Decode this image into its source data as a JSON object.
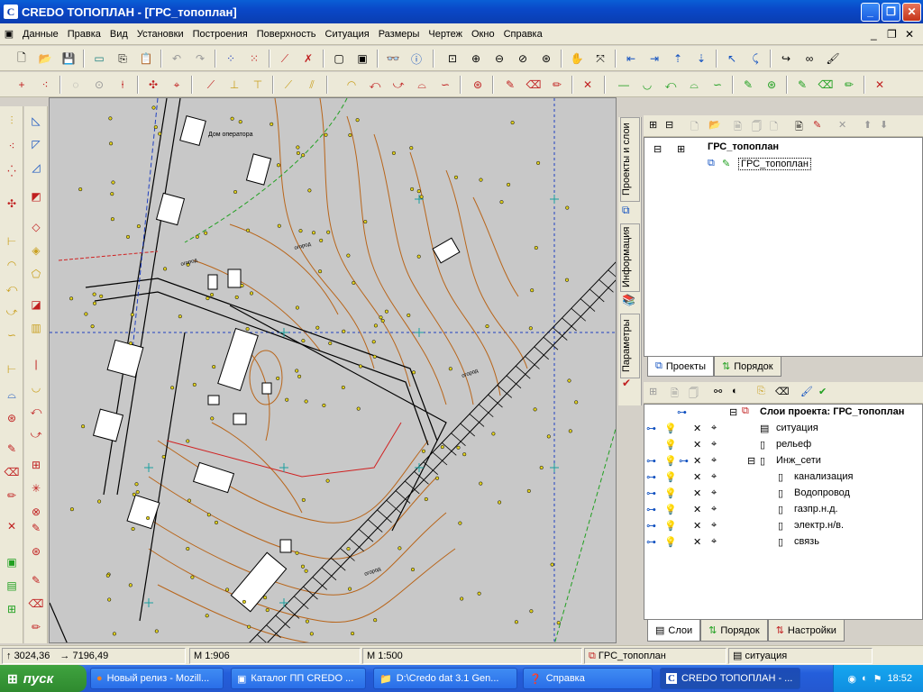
{
  "window": {
    "title": "CREDO ТОПОПЛАН - [ГРС_топоплан]",
    "app_letter": "C"
  },
  "menu": [
    "Данные",
    "Правка",
    "Вид",
    "Установки",
    "Построения",
    "Поверхность",
    "Ситуация",
    "Размеры",
    "Чертеж",
    "Окно",
    "Справка"
  ],
  "side_tabs": [
    "Проекты и слои",
    "Информация",
    "Параметры"
  ],
  "projects_panel": {
    "root": "ГРС_топоплан",
    "child": "ГРС_топоплан",
    "tabs": [
      "Проекты",
      "Порядок"
    ]
  },
  "layers_panel": {
    "header": "Слои проекта: ГРС_топоплан",
    "layers": [
      "ситуация",
      "рельеф",
      "Инж_сети",
      "канализация",
      "Водопровод",
      "газпр.н.д.",
      "электр.н/в.",
      "связь"
    ],
    "tabs": [
      "Слои",
      "Порядок",
      "Настройки"
    ]
  },
  "status": {
    "coord_y": "3024,36",
    "coord_x": "7196,49",
    "scale1": "М 1:906",
    "scale2": "М 1:500",
    "project": "ГРС_топоплан",
    "layer": "ситуация"
  },
  "taskbar": {
    "start": "пуск",
    "tasks": [
      "Новый релиз - Mozill...",
      "Каталог ПП CREDO ...",
      "D:\\Credo dat 3.1 Gen...",
      "Справка",
      "CREDO ТОПОПЛАН - ..."
    ],
    "time": "18:52"
  },
  "map_labels": [
    "Дом оператора",
    "огород",
    "огород",
    "огород",
    "огород"
  ],
  "colors": {
    "accent": "#0a3db0",
    "contour": "#b8651a",
    "road": "#000000",
    "grid": "#1a9f9f"
  }
}
